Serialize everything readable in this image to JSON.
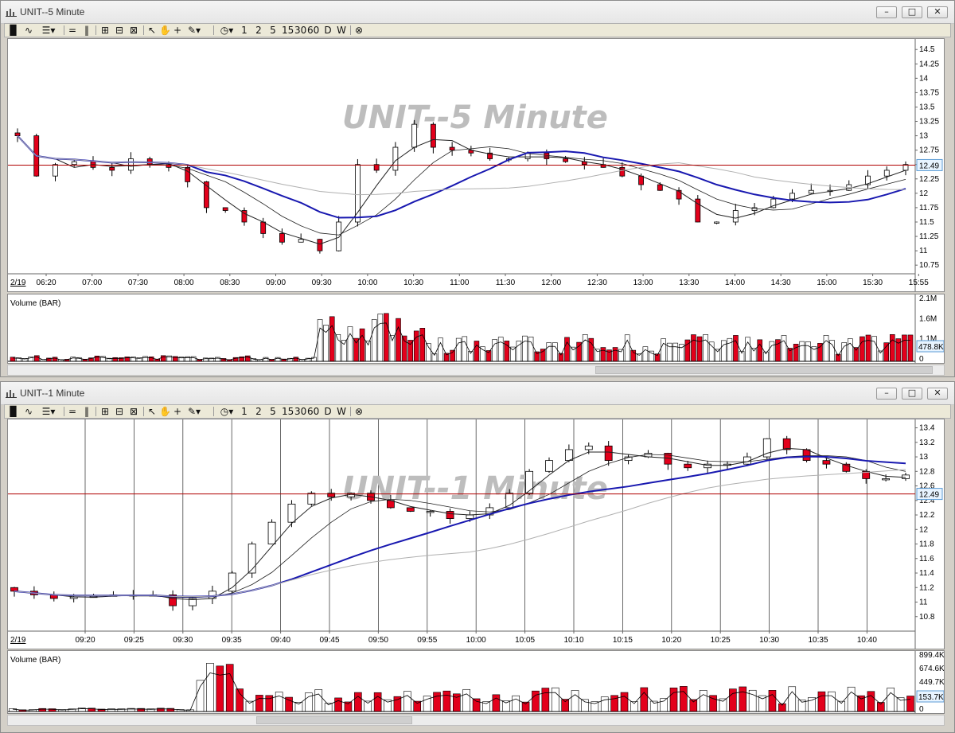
{
  "windows": [
    {
      "id": "w5",
      "title": "UNIT--5 Minute",
      "watermark": "UNIT--5 Minute",
      "toolbar": {
        "periods": [
          "1",
          "2",
          "5",
          "15",
          "30",
          "60",
          "D",
          "W"
        ]
      },
      "date_label": "2/19",
      "time_labels": [
        "06:20",
        "07:00",
        "07:30",
        "08:00",
        "08:30",
        "09:00",
        "09:30",
        "10:00",
        "10:30",
        "11:00",
        "11:30",
        "12:00",
        "12:30",
        "13:00",
        "13:30",
        "14:00",
        "14:30",
        "15:00",
        "15:30",
        "15:55"
      ],
      "price_ticks": [
        "14.5",
        "14.25",
        "14",
        "13.75",
        "13.5",
        "13.25",
        "13",
        "12.75",
        "12.5",
        "12.25",
        "12",
        "11.75",
        "11.5",
        "11.25",
        "11",
        "10.75"
      ],
      "last_price": "12.49",
      "volume_label": "Volume (BAR)",
      "volume_ticks": [
        "2.1M",
        "1.6M",
        "1.1M",
        "0"
      ],
      "last_volume": "478.8K"
    },
    {
      "id": "w1",
      "title": "UNIT--1 Minute",
      "watermark": "UNIT--1 Minute",
      "toolbar": {
        "periods": [
          "1",
          "2",
          "5",
          "15",
          "30",
          "60",
          "D",
          "W"
        ]
      },
      "date_label": "2/19",
      "time_labels": [
        "09:20",
        "09:25",
        "09:30",
        "09:35",
        "09:40",
        "09:45",
        "09:50",
        "09:55",
        "10:00",
        "10:05",
        "10:10",
        "10:15",
        "10:20",
        "10:25",
        "10:30",
        "10:35",
        "10:40"
      ],
      "price_ticks": [
        "13.4",
        "13.2",
        "13",
        "12.8",
        "12.6",
        "12.4",
        "12.2",
        "12",
        "11.8",
        "11.6",
        "11.4",
        "11.2",
        "11",
        "10.8"
      ],
      "last_price": "12.49",
      "volume_label": "Volume (BAR)",
      "volume_ticks": [
        "899.4K",
        "674.6K",
        "449.7K",
        "224.9K",
        "0"
      ],
      "last_volume": "153.7K"
    }
  ],
  "chart_data": [
    {
      "type": "candlestick",
      "title": "UNIT--5 Minute",
      "ylim": [
        10.6,
        14.6
      ],
      "x": [
        "06:20",
        "07:00",
        "07:30",
        "08:00",
        "08:30",
        "09:00",
        "09:30",
        "10:00",
        "10:30",
        "11:00",
        "11:30",
        "12:00",
        "12:30",
        "13:00",
        "13:30",
        "14:00",
        "14:30",
        "15:00",
        "15:30",
        "15:55"
      ],
      "close_path": [
        13.0,
        12.3,
        12.5,
        12.55,
        12.45,
        12.4,
        12.6,
        12.5,
        12.45,
        12.2,
        11.75,
        11.7,
        11.5,
        11.3,
        11.15,
        11.2,
        11.0,
        11.5,
        12.5,
        12.4,
        12.8,
        13.2,
        12.8,
        12.75,
        12.7,
        12.6,
        12.6,
        12.7,
        12.6,
        12.55,
        12.5,
        12.45,
        12.3,
        12.15,
        12.05,
        11.9,
        11.5,
        11.5,
        11.7,
        11.75,
        11.9,
        12.0,
        12.05,
        12.05,
        12.15,
        12.3,
        12.4,
        12.5
      ],
      "horizontal_line": 12.49,
      "volume_peak": 2100000
    },
    {
      "type": "candlestick",
      "title": "UNIT--1 Minute",
      "ylim": [
        10.6,
        13.45
      ],
      "x": [
        "09:20",
        "09:25",
        "09:30",
        "09:35",
        "09:40",
        "09:45",
        "09:50",
        "09:55",
        "10:00",
        "10:05",
        "10:10",
        "10:15",
        "10:20",
        "10:25",
        "10:30",
        "10:35",
        "10:40"
      ],
      "close_path": [
        11.15,
        11.1,
        11.05,
        11.07,
        11.08,
        11.1,
        11.1,
        11.1,
        10.95,
        11.05,
        11.15,
        11.4,
        11.8,
        12.1,
        12.35,
        12.5,
        12.45,
        12.5,
        12.4,
        12.3,
        12.25,
        12.25,
        12.15,
        12.2,
        12.3,
        12.5,
        12.8,
        12.95,
        13.1,
        13.15,
        12.95,
        13.0,
        13.05,
        12.9,
        12.85,
        12.9,
        12.9,
        13.0,
        13.25,
        13.1,
        12.95,
        12.9,
        12.8,
        12.7,
        12.7,
        12.75
      ],
      "horizontal_line": 12.49,
      "volume_peak": 899400
    }
  ],
  "colors": {
    "up": "#ffffff",
    "down": "#e3001b",
    "ma_blue": "#1818b0",
    "ma_dark": "#202020",
    "ma_light": "#b0b0b0",
    "hline": "#b00000",
    "tag": "#5b9bd5"
  }
}
